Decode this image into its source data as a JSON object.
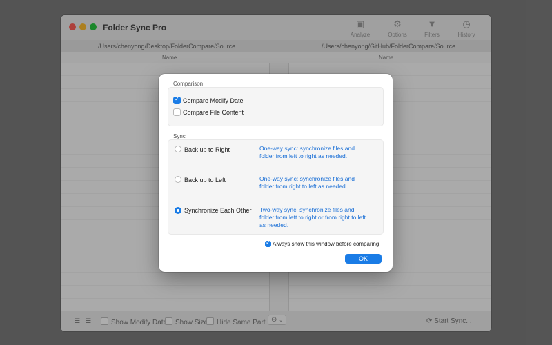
{
  "window": {
    "title": "Folder Sync Pro",
    "toolbar": [
      {
        "label": "Analyze",
        "icon": "analyze-icon"
      },
      {
        "label": "Options",
        "icon": "gear-icon"
      },
      {
        "label": "Filters",
        "icon": "filter-icon"
      },
      {
        "label": "History",
        "icon": "clock-icon"
      }
    ],
    "left_path": "/Users/chenyong/Desktop/FolderCompare/Source",
    "path_separator": "...",
    "right_path": "/Users/chenyong/GitHub/FolderCompare/Source",
    "left_column": "Name",
    "right_column": "Name",
    "bottom": {
      "show_modify_date": "Show Modify Date",
      "show_size": "Show Size",
      "hide_same_part": "Hide Same Part",
      "start_sync": "Start Sync..."
    }
  },
  "dialog": {
    "comparison_label": "Comparison",
    "compare_modify_date": {
      "label": "Compare Modify Date",
      "checked": true
    },
    "compare_file_content": {
      "label": "Compare File Content",
      "checked": false
    },
    "sync_label": "Sync",
    "options": [
      {
        "label": "Back up to Right",
        "desc": "One-way sync: synchronize files and folder from left to right as needed.",
        "selected": false
      },
      {
        "label": "Back up to Left",
        "desc": "One-way sync: synchronize files and folder from right to left as needed.",
        "selected": false
      },
      {
        "label": "Synchronize Each Other",
        "desc": "Two-way sync: synchronize files and folder from left to right or from right to left as needed.",
        "selected": true
      }
    ],
    "always_show": {
      "label": "Always show this window before comparing",
      "checked": true
    },
    "ok_label": "OK"
  },
  "colors": {
    "accent": "#1a7ce6",
    "description_text": "#1a6fd6"
  }
}
